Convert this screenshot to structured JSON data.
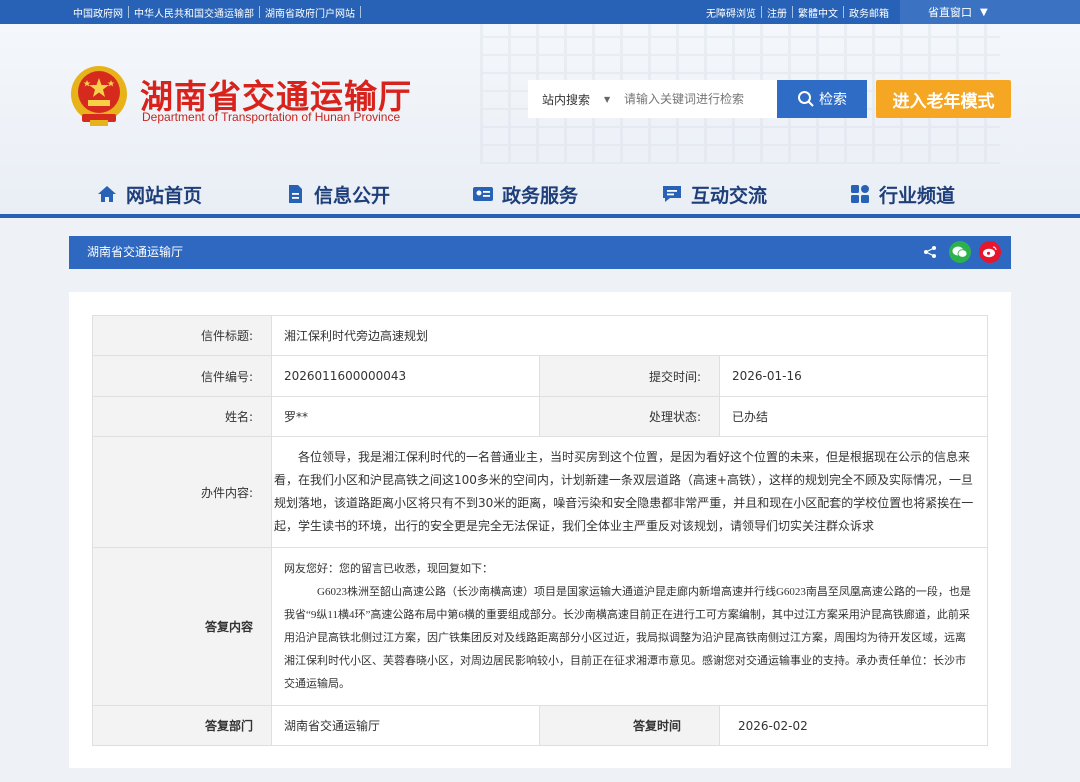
{
  "topbar": {
    "links": [
      "中国政府网",
      "中华人民共和国交通运输部",
      "湖南省政府门户网站"
    ],
    "accessibility": "无障碍浏览",
    "register": "注册",
    "traditional": "繁體中文",
    "mail": "政务邮箱",
    "province_window": "省直窗口",
    "province_window_caret": "▼"
  },
  "header": {
    "title": "湖南省交通运输厅",
    "subtitle": "Department of Transportation of Hunan Province"
  },
  "search": {
    "scope": "站内搜索",
    "scope_caret": "▼",
    "placeholder": "请输入关键词进行检索",
    "button": "检索"
  },
  "elder_mode": "进入老年模式",
  "nav": {
    "items": [
      {
        "label": "网站首页",
        "icon": "home-icon"
      },
      {
        "label": "信息公开",
        "icon": "document-icon"
      },
      {
        "label": "政务服务",
        "icon": "id-card-icon"
      },
      {
        "label": "互动交流",
        "icon": "chat-icon"
      },
      {
        "label": "行业频道",
        "icon": "grid-icon"
      }
    ]
  },
  "breadcrumb": "湖南省交通运输厅",
  "share": [
    "share-icon",
    "wechat-icon",
    "weibo-icon"
  ],
  "colors": {
    "primary": "#2762b6",
    "title_red": "#d8231c",
    "elder_orange": "#f5a623"
  },
  "letter": {
    "title_label": "信件标题:",
    "title": "湘江保利时代旁边高速规划",
    "number_label": "信件编号:",
    "number": "2026011600000043",
    "submit_time_label": "提交时间:",
    "submit_time": "2026-01-16",
    "name_label": "姓名:",
    "name": "罗**",
    "status_label": "处理状态:",
    "status": "已办结",
    "content_label": "办件内容:",
    "content": "各位领导，我是湘江保利时代的一名普通业主，当时买房到这个位置，是因为看好这个位置的未来，但是根据现在公示的信息来看，在我们小区和沪昆高铁之间这100多米的空间内，计划新建一条双层道路（高速+高铁），这样的规划完全不顾及实际情况，一旦规划落地，该道路距离小区将只有不到30米的距离，噪音污染和安全隐患都非常严重，并且和现在小区配套的学校位置也将紧挨在一起，学生读书的环境，出行的安全更是完全无法保证，我们全体业主严重反对该规划，请领导们切实关注群众诉求",
    "reply_label": "答复内容",
    "reply_greeting": "网友您好：您的留言已收悉，现回复如下：",
    "reply_body": "G6023株洲至韶山高速公路（长沙南横高速）项目是国家运输大通道沪昆走廊内新增高速并行线G6023南昌至凤凰高速公路的一段，也是我省“9纵11横4环”高速公路布局中第6横的重要组成部分。长沙南横高速目前正在进行工可方案编制，其中过江方案采用沪昆高铁廊道，此前采用沿沪昆高铁北侧过江方案，因广铁集团反对及线路距离部分小区过近，我局拟调整为沿沪昆高铁南侧过江方案，周围均为待开发区域，远离湘江保利时代小区、芙蓉春晓小区，对周边居民影响较小，目前正在征求湘潭市意见。感谢您对交通运输事业的支持。承办责任单位：长沙市交通运输局。",
    "reply_dept_label": "答复部门",
    "reply_dept": "湖南省交通运输厅",
    "reply_time_label": "答复时间",
    "reply_time": "2026-02-02"
  }
}
